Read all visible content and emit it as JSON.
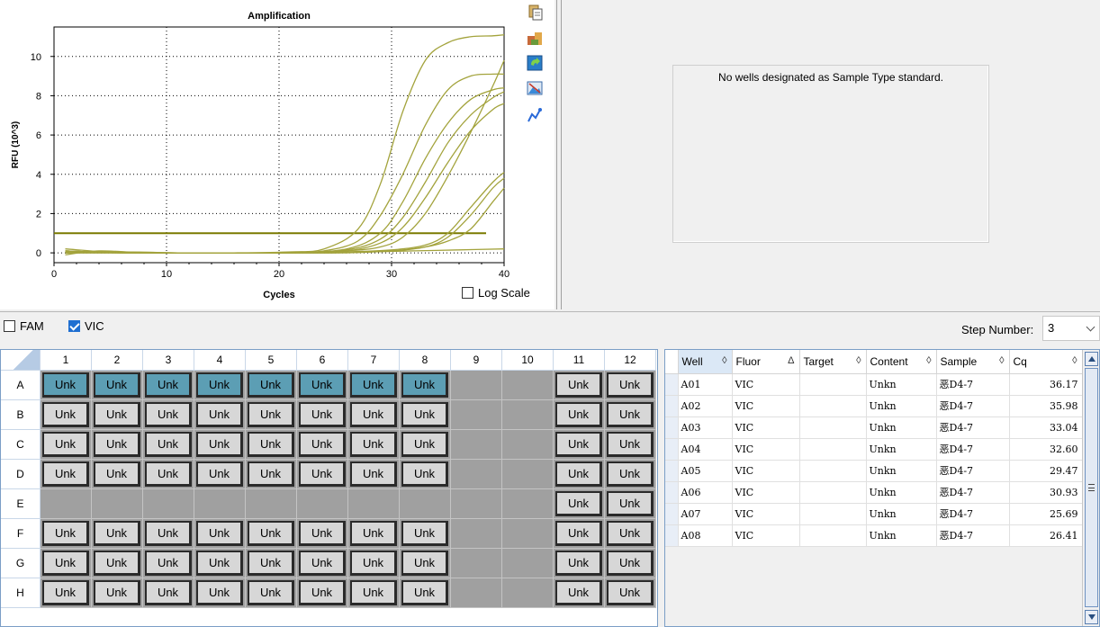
{
  "chart_data": {
    "type": "line",
    "title": "Amplification",
    "xlabel": "Cycles",
    "ylabel": "RFU (10^3)",
    "xlim": [
      0,
      40
    ],
    "ylim": [
      -0.5,
      11.5
    ],
    "xticks": [
      0,
      10,
      20,
      30,
      40
    ],
    "yticks": [
      0,
      2,
      4,
      6,
      8,
      10
    ],
    "grid": true,
    "log_scale_label": "Log Scale",
    "log_scale_checked": false,
    "threshold": 1.0,
    "line_color": "#a3a33c",
    "threshold_color": "#7a7a00",
    "series": [
      {
        "x": [
          1,
          6,
          11,
          16,
          21,
          24,
          27,
          29,
          31,
          33,
          35,
          37,
          39,
          40
        ],
        "y": [
          0.05,
          0.05,
          0.0,
          0.0,
          0.05,
          0.2,
          1.2,
          3.5,
          7.2,
          9.8,
          10.7,
          11.0,
          11.05,
          11.1
        ]
      },
      {
        "x": [
          1,
          6,
          11,
          16,
          21,
          24,
          27,
          29,
          31,
          33,
          35,
          37,
          39,
          40
        ],
        "y": [
          0.1,
          0.0,
          0.0,
          0.0,
          0.0,
          0.1,
          0.6,
          1.9,
          4.0,
          6.5,
          8.3,
          9.0,
          9.1,
          9.1
        ]
      },
      {
        "x": [
          1,
          6,
          11,
          16,
          21,
          26,
          29,
          31,
          33,
          35,
          37,
          39,
          40
        ],
        "y": [
          0.1,
          0.0,
          0.0,
          0.0,
          0.0,
          0.2,
          1.0,
          2.6,
          4.8,
          6.6,
          7.8,
          8.3,
          8.4
        ]
      },
      {
        "x": [
          1,
          6,
          11,
          16,
          21,
          26,
          29,
          31,
          33,
          35,
          37,
          39,
          40
        ],
        "y": [
          0.1,
          0.0,
          0.0,
          0.0,
          0.0,
          0.15,
          0.7,
          1.8,
          3.6,
          5.6,
          7.0,
          7.9,
          8.2
        ]
      },
      {
        "x": [
          1,
          6,
          11,
          16,
          21,
          26,
          29,
          31,
          33,
          35,
          37,
          39,
          40
        ],
        "y": [
          0.1,
          0.0,
          0.0,
          0.0,
          0.0,
          0.1,
          0.5,
          1.3,
          2.8,
          4.6,
          6.2,
          7.3,
          7.6
        ]
      },
      {
        "x": [
          1,
          6,
          11,
          16,
          21,
          26,
          29,
          31,
          33,
          35,
          37,
          39,
          40
        ],
        "y": [
          0.2,
          0.0,
          0.0,
          0.0,
          0.0,
          0.1,
          0.3,
          0.8,
          2.0,
          3.9,
          6.1,
          8.5,
          9.8
        ]
      },
      {
        "x": [
          1,
          6,
          11,
          16,
          21,
          26,
          30,
          33,
          35,
          37,
          39,
          40
        ],
        "y": [
          0.0,
          0.0,
          0.0,
          0.0,
          0.0,
          0.05,
          0.15,
          0.4,
          1.0,
          2.3,
          3.6,
          4.1
        ]
      },
      {
        "x": [
          1,
          6,
          11,
          16,
          21,
          26,
          30,
          33,
          35,
          37,
          39,
          40
        ],
        "y": [
          0.0,
          0.0,
          0.0,
          0.0,
          0.0,
          0.05,
          0.1,
          0.3,
          0.8,
          1.9,
          3.3,
          3.8
        ]
      },
      {
        "x": [
          1,
          6,
          11,
          16,
          21,
          26,
          30,
          33,
          35,
          37,
          39,
          40
        ],
        "y": [
          0.0,
          0.05,
          0.0,
          0.0,
          0.0,
          0.0,
          0.1,
          0.3,
          0.6,
          1.2,
          2.6,
          3.3
        ]
      },
      {
        "x": [
          1,
          4,
          8,
          12,
          16,
          20,
          24,
          28,
          32,
          36,
          40
        ],
        "y": [
          -0.1,
          0.1,
          0.0,
          0.0,
          0.0,
          0.0,
          0.0,
          0.05,
          0.1,
          0.15,
          0.2
        ]
      }
    ]
  },
  "toolbar": {
    "icons": [
      "copy-icon",
      "export-icon",
      "refresh-icon",
      "image-icon",
      "chart-style-icon"
    ]
  },
  "standard_panel": {
    "message": "No wells designated as Sample Type standard."
  },
  "fluors": [
    {
      "label": "FAM",
      "checked": false
    },
    {
      "label": "VIC",
      "checked": true
    }
  ],
  "step": {
    "label": "Step Number:",
    "value": "3"
  },
  "plate": {
    "columns": [
      "1",
      "2",
      "3",
      "4",
      "5",
      "6",
      "7",
      "8",
      "9",
      "10",
      "11",
      "12"
    ],
    "rows": [
      "A",
      "B",
      "C",
      "D",
      "E",
      "F",
      "G",
      "H"
    ],
    "well_label": "Unk",
    "wells": [
      [
        "sel",
        "sel",
        "sel",
        "sel",
        "sel",
        "sel",
        "sel",
        "sel",
        "",
        "",
        "unk",
        "unk"
      ],
      [
        "unk",
        "unk",
        "unk",
        "unk",
        "unk",
        "unk",
        "unk",
        "unk",
        "",
        "",
        "unk",
        "unk"
      ],
      [
        "unk",
        "unk",
        "unk",
        "unk",
        "unk",
        "unk",
        "unk",
        "unk",
        "",
        "",
        "unk",
        "unk"
      ],
      [
        "unk",
        "unk",
        "unk",
        "unk",
        "unk",
        "unk",
        "unk",
        "unk",
        "",
        "",
        "unk",
        "unk"
      ],
      [
        "",
        "",
        "",
        "",
        "",
        "",
        "",
        "",
        "",
        "",
        "unk",
        "unk"
      ],
      [
        "unk",
        "unk",
        "unk",
        "unk",
        "unk",
        "unk",
        "unk",
        "unk",
        "",
        "",
        "unk",
        "unk"
      ],
      [
        "unk",
        "unk",
        "unk",
        "unk",
        "unk",
        "unk",
        "unk",
        "unk",
        "",
        "",
        "unk",
        "unk"
      ],
      [
        "unk",
        "unk",
        "unk",
        "unk",
        "unk",
        "unk",
        "unk",
        "unk",
        "",
        "",
        "unk",
        "unk"
      ]
    ]
  },
  "results": {
    "headers": [
      {
        "label": "Well",
        "sort": "◊"
      },
      {
        "label": "Fluor",
        "sort": "Δ"
      },
      {
        "label": "Target",
        "sort": "◊"
      },
      {
        "label": "Content",
        "sort": "◊"
      },
      {
        "label": "Sample",
        "sort": "◊"
      },
      {
        "label": "Cq",
        "sort": "◊"
      }
    ],
    "rows": [
      [
        "A01",
        "VIC",
        "",
        "Unkn",
        "恶D4-7",
        "36.17"
      ],
      [
        "A02",
        "VIC",
        "",
        "Unkn",
        "恶D4-7",
        "35.98"
      ],
      [
        "A03",
        "VIC",
        "",
        "Unkn",
        "恶D4-7",
        "33.04"
      ],
      [
        "A04",
        "VIC",
        "",
        "Unkn",
        "恶D4-7",
        "32.60"
      ],
      [
        "A05",
        "VIC",
        "",
        "Unkn",
        "恶D4-7",
        "29.47"
      ],
      [
        "A06",
        "VIC",
        "",
        "Unkn",
        "恶D4-7",
        "30.93"
      ],
      [
        "A07",
        "VIC",
        "",
        "Unkn",
        "恶D4-7",
        "25.69"
      ],
      [
        "A08",
        "VIC",
        "",
        "Unkn",
        "恶D4-7",
        "26.41"
      ]
    ]
  }
}
